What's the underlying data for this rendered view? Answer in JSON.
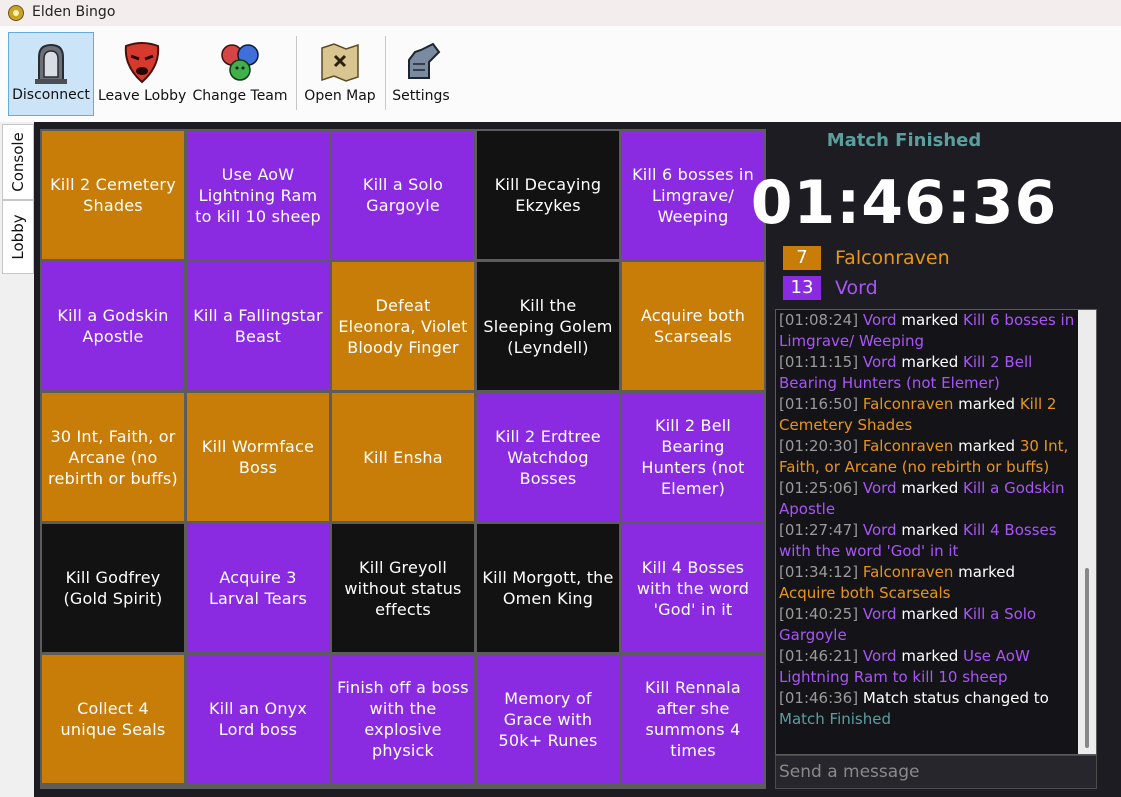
{
  "window": {
    "title": "Elden Bingo"
  },
  "toolbar": {
    "disconnect_label": "Disconnect",
    "leave_lobby_label": "Leave Lobby",
    "change_team_label": "Change Team",
    "open_map_label": "Open Map",
    "settings_label": "Settings"
  },
  "sidetabs": {
    "console_label": "Console",
    "lobby_label": "Lobby"
  },
  "colors": {
    "falconraven": "#c77d07",
    "vord": "#8a2be2",
    "unclaimed": "#121212",
    "status": "#5b9e9e"
  },
  "board": {
    "cells": [
      {
        "text": "Kill 2 Cemetery Shades",
        "owner": "falconraven"
      },
      {
        "text": "Use AoW Lightning Ram to kill 10 sheep",
        "owner": "vord"
      },
      {
        "text": "Kill a Solo Gargoyle",
        "owner": "vord"
      },
      {
        "text": "Kill Decaying Ekzykes",
        "owner": "none"
      },
      {
        "text": "Kill 6 bosses in Limgrave/ Weeping",
        "owner": "vord"
      },
      {
        "text": "Kill a Godskin Apostle",
        "owner": "vord"
      },
      {
        "text": "Kill a Fallingstar Beast",
        "owner": "vord"
      },
      {
        "text": "Defeat Eleonora, Violet Bloody Finger",
        "owner": "falconraven"
      },
      {
        "text": "Kill the Sleeping Golem (Leyndell)",
        "owner": "none"
      },
      {
        "text": "Acquire both Scarseals",
        "owner": "falconraven"
      },
      {
        "text": "30 Int, Faith, or Arcane (no rebirth or buffs)",
        "owner": "falconraven"
      },
      {
        "text": "Kill Wormface Boss",
        "owner": "falconraven"
      },
      {
        "text": "Kill Ensha",
        "owner": "falconraven"
      },
      {
        "text": "Kill 2 Erdtree Watchdog Bosses",
        "owner": "vord"
      },
      {
        "text": "Kill 2 Bell Bearing Hunters (not Elemer)",
        "owner": "vord"
      },
      {
        "text": "Kill Godfrey (Gold Spirit)",
        "owner": "none"
      },
      {
        "text": "Acquire 3 Larval Tears",
        "owner": "vord"
      },
      {
        "text": "Kill Greyoll without status effects",
        "owner": "none"
      },
      {
        "text": "Kill Morgott, the Omen King",
        "owner": "none"
      },
      {
        "text": "Kill 4 Bosses with the word 'God' in it",
        "owner": "vord"
      },
      {
        "text": "Collect 4 unique Seals",
        "owner": "falconraven"
      },
      {
        "text": "Kill an Onyx Lord boss",
        "owner": "vord"
      },
      {
        "text": "Finish off a boss with the explosive physick",
        "owner": "vord"
      },
      {
        "text": "Memory of Grace with 50k+ Runes",
        "owner": "vord"
      },
      {
        "text": "Kill Rennala after she summons 4 times",
        "owner": "vord"
      }
    ]
  },
  "match": {
    "status": "Match Finished",
    "timer": "01:46:36",
    "teams": [
      {
        "score": "7",
        "name": "Falconraven",
        "key": "falconraven"
      },
      {
        "score": "13",
        "name": "Vord",
        "key": "vord"
      }
    ]
  },
  "log": [
    {
      "ts": "[01:08:24]",
      "player": "Vord",
      "team": "vord",
      "action": "marked",
      "goal": "Kill 6 bosses in Limgrave/ Weeping"
    },
    {
      "ts": "[01:11:15]",
      "player": "Vord",
      "team": "vord",
      "action": "marked",
      "goal": "Kill 2 Bell Bearing Hunters (not Elemer)"
    },
    {
      "ts": "[01:16:50]",
      "player": "Falconraven",
      "team": "falconraven",
      "action": "marked",
      "goal": "Kill 2 Cemetery Shades"
    },
    {
      "ts": "[01:20:30]",
      "player": "Falconraven",
      "team": "falconraven",
      "action": "marked",
      "goal": "30 Int, Faith, or Arcane (no rebirth or buffs)"
    },
    {
      "ts": "[01:25:06]",
      "player": "Vord",
      "team": "vord",
      "action": "marked",
      "goal": "Kill a Godskin Apostle"
    },
    {
      "ts": "[01:27:47]",
      "player": "Vord",
      "team": "vord",
      "action": "marked",
      "goal": "Kill 4 Bosses with the word 'God' in it"
    },
    {
      "ts": "[01:34:12]",
      "player": "Falconraven",
      "team": "falconraven",
      "action": "marked",
      "goal": "Acquire both Scarseals"
    },
    {
      "ts": "[01:40:25]",
      "player": "Vord",
      "team": "vord",
      "action": "marked",
      "goal": "Kill a Solo Gargoyle"
    },
    {
      "ts": "[01:46:21]",
      "player": "Vord",
      "team": "vord",
      "action": "marked",
      "goal": "Use AoW Lightning Ram to kill 10 sheep"
    },
    {
      "ts": "[01:46:36]",
      "player": "",
      "team": "system",
      "action": "Match status changed to",
      "goal": "Match Finished"
    }
  ],
  "chat": {
    "placeholder": "Send a message"
  }
}
